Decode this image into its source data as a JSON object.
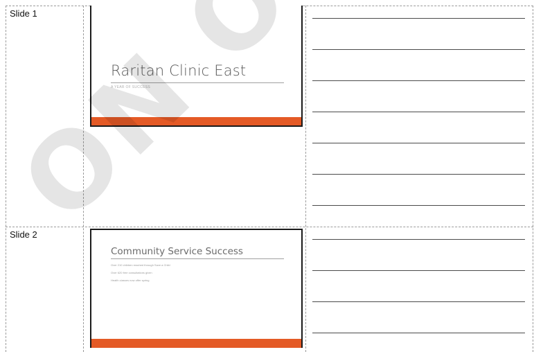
{
  "watermark": "ON ONL",
  "slides": [
    {
      "label": "Slide 1",
      "title": "Raritan Clinic East",
      "subtitle": "A YEAR OF SUCCESS"
    },
    {
      "label": "Slide 2",
      "title": "Community Service Success",
      "bullets": [
        "Over 210 children reached through Save a Child",
        "Over 620 free consultations given",
        "Health classes now offer spring"
      ]
    }
  ],
  "colors": {
    "accent_bar": "#e45a26",
    "grid": "#9a9a9a",
    "note_line": "#4a4a4a"
  }
}
